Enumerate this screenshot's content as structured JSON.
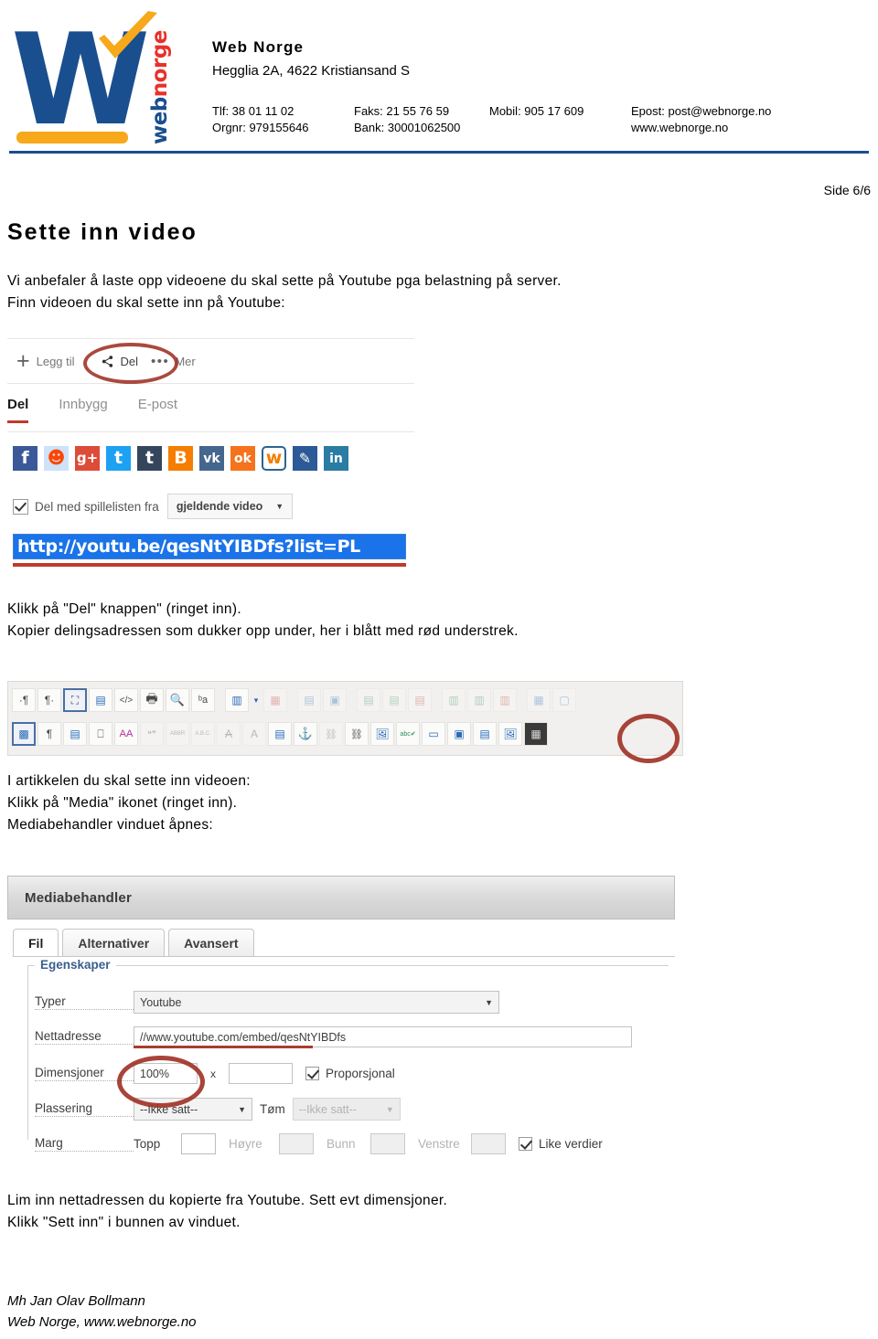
{
  "letterhead": {
    "logo": {
      "letter": "W",
      "vertical_web": "web",
      "vertical_norge": "norge"
    },
    "company_name": "Web Norge",
    "address": "Hegglia 2A, 4622 Kristiansand S",
    "contacts": {
      "tlf": "Tlf: 38 01 11 02",
      "faks": "Faks: 21 55 76 59",
      "mobil": "Mobil: 905 17 609",
      "epost": "Epost: post@webnorge.no",
      "orgnr": "Orgnr: 979155646",
      "bank": "Bank: 30001062500",
      "web": "www.webnorge.no"
    }
  },
  "page": {
    "page_number": "Side 6/6",
    "title": "Sette inn video",
    "intro": "Vi anbefaler å laste opp videoene du skal sette på Youtube pga belastning på server.\nFinn videoen du skal sette inn på Youtube:",
    "after_share": "Klikk på \"Del\" knappen\" (ringet inn).\nKopier delingsadressen som dukker opp under, her i blått med rød understrek.",
    "after_toolbar": "I artikkelen du skal sette inn videoen:\nKlikk på \"Media\" ikonet (ringet inn).\nMediabehandler vinduet åpnes:",
    "after_dialog": "Lim inn nettadressen du kopierte fra Youtube. Sett evt dimensjoner.\nKlikk \"Sett inn\" i bunnen av vinduet.",
    "signature": "Mh Jan Olav Bollmann\nWeb Norge, www.webnorge.no"
  },
  "youtube_share": {
    "toolbar": {
      "add_label": "Legg til",
      "share_label": "Del",
      "more_label": "Mer",
      "dots": "•••"
    },
    "tabs": [
      {
        "label": "Del",
        "active": true
      },
      {
        "label": "Innbygg",
        "active": false
      },
      {
        "label": "E-post",
        "active": false
      }
    ],
    "socials": [
      {
        "name": "facebook",
        "glyph": "f",
        "bg": "#3b5998",
        "fg": "#ffffff"
      },
      {
        "name": "reddit",
        "glyph": "☻",
        "bg": "#cee3f8",
        "fg": "#ff4500"
      },
      {
        "name": "google-plus",
        "glyph": "g+",
        "bg": "#dd4b39",
        "fg": "#ffffff"
      },
      {
        "name": "twitter",
        "glyph": "t",
        "bg": "#1da1f2",
        "fg": "#ffffff"
      },
      {
        "name": "tumblr",
        "glyph": "t",
        "bg": "#35465c",
        "fg": "#ffffff"
      },
      {
        "name": "blogger",
        "glyph": "B",
        "bg": "#f57d00",
        "fg": "#ffffff"
      },
      {
        "name": "vk",
        "glyph": "vk",
        "bg": "#45668e",
        "fg": "#ffffff"
      },
      {
        "name": "odnoklassniki",
        "glyph": "ok",
        "bg": "#f4731c",
        "fg": "#ffffff"
      },
      {
        "name": "weibo",
        "glyph": "w",
        "bg": "#ffffff",
        "fg": "#f57d00"
      },
      {
        "name": "pencil-blog",
        "glyph": "✎",
        "bg": "#2b5a96",
        "fg": "#ffffff"
      },
      {
        "name": "linkedin",
        "glyph": "in",
        "bg": "#2a7ca3",
        "fg": "#ffffff"
      }
    ],
    "playlist": {
      "checkbox_label": "Del med spillelisten fra",
      "checked": true,
      "select_value": "gjeldende video",
      "caret": "▼"
    },
    "url": "http://youtu.be/qesNtYIBDfs?list=PL"
  },
  "editor_toolbar": {
    "row1": [
      {
        "name": "pilcrow-ltr-icon",
        "glyph": "·¶",
        "state": "normal"
      },
      {
        "name": "pilcrow-rtl-icon",
        "glyph": "¶·",
        "state": "normal"
      },
      {
        "name": "fullscreen-icon",
        "glyph": "⛶",
        "state": "selected"
      },
      {
        "name": "edit-source-icon",
        "glyph": "▤",
        "state": "normal"
      },
      {
        "name": "html-code-icon",
        "glyph": "<>",
        "state": "normal"
      },
      {
        "name": "print-icon",
        "glyph": "🖶",
        "state": "normal"
      },
      {
        "name": "search-icon",
        "glyph": "⚲⚲",
        "state": "normal"
      },
      {
        "name": "replace-icon",
        "glyph": "ᵇa",
        "state": "normal"
      },
      {
        "name": "sep",
        "glyph": "",
        "state": "sep"
      },
      {
        "name": "template-icon",
        "glyph": "▥",
        "state": "normal"
      },
      {
        "name": "template-dropdown-icon",
        "glyph": "▾",
        "state": "caret"
      },
      {
        "name": "delete-table-icon",
        "glyph": "▦",
        "state": "dim"
      },
      {
        "name": "sep",
        "glyph": "",
        "state": "sep"
      },
      {
        "name": "row-properties-icon",
        "glyph": "▤",
        "state": "dim"
      },
      {
        "name": "cell-properties-icon",
        "glyph": "▣",
        "state": "dim"
      },
      {
        "name": "sep",
        "glyph": "",
        "state": "sep"
      },
      {
        "name": "insert-row-before-icon",
        "glyph": "▤",
        "state": "dim"
      },
      {
        "name": "insert-row-after-icon",
        "glyph": "▤",
        "state": "dim"
      },
      {
        "name": "delete-row-icon",
        "glyph": "▤",
        "state": "dim"
      },
      {
        "name": "sep",
        "glyph": "",
        "state": "sep"
      },
      {
        "name": "insert-col-before-icon",
        "glyph": "▥",
        "state": "dim"
      },
      {
        "name": "insert-col-after-icon",
        "glyph": "▥",
        "state": "dim"
      },
      {
        "name": "delete-col-icon",
        "glyph": "▥",
        "state": "dim"
      },
      {
        "name": "sep",
        "glyph": "",
        "state": "sep"
      },
      {
        "name": "split-cell-icon",
        "glyph": "▦",
        "state": "dim"
      },
      {
        "name": "merge-cell-icon",
        "glyph": "▢",
        "state": "dim"
      }
    ],
    "row2": [
      {
        "name": "show-blocks-icon",
        "glyph": "▩",
        "state": "selected"
      },
      {
        "name": "paragraph-icon",
        "glyph": "¶",
        "state": "normal"
      },
      {
        "name": "page-properties-icon",
        "glyph": "▤",
        "state": "normal"
      },
      {
        "name": "page-break-icon",
        "glyph": "⎕",
        "state": "normal"
      },
      {
        "name": "font-style-icon",
        "glyph": "AA",
        "state": "normal"
      },
      {
        "name": "blockquote-icon",
        "glyph": "❝❞",
        "state": "dim"
      },
      {
        "name": "abbreviation-icon",
        "glyph": "ABBR",
        "state": "dim"
      },
      {
        "name": "acronym-icon",
        "glyph": "A.B.C.",
        "state": "dim"
      },
      {
        "name": "strikethrough-icon",
        "glyph": "A̶",
        "state": "dim"
      },
      {
        "name": "underline-icon",
        "glyph": "A",
        "state": "dim"
      },
      {
        "name": "notes-icon",
        "glyph": "▤",
        "state": "normal"
      },
      {
        "name": "anchor-icon",
        "glyph": "⚓",
        "state": "normal"
      },
      {
        "name": "unlink-icon",
        "glyph": "⛓",
        "state": "dim"
      },
      {
        "name": "link-icon",
        "glyph": "⛓",
        "state": "normal"
      },
      {
        "name": "insert-image-icon",
        "glyph": "🖼",
        "state": "normal"
      },
      {
        "name": "spellcheck-icon",
        "glyph": "abc✔",
        "state": "normal"
      },
      {
        "name": "insert-layer-icon",
        "glyph": "▭",
        "state": "normal"
      },
      {
        "name": "layout-icon",
        "glyph": "▣",
        "state": "normal"
      },
      {
        "name": "attachment-icon",
        "glyph": "▤",
        "state": "normal"
      },
      {
        "name": "image-manager-icon",
        "glyph": "🖼",
        "state": "normal"
      },
      {
        "name": "media-icon",
        "glyph": "▦",
        "state": "media"
      }
    ]
  },
  "mediabehandler": {
    "title": "Mediabehandler",
    "tabs": [
      {
        "label": "Fil",
        "active": true
      },
      {
        "label": "Alternativer",
        "active": false
      },
      {
        "label": "Avansert",
        "active": false
      }
    ],
    "legend": "Egenskaper",
    "fields": {
      "typer_label": "Typer",
      "typer_value": "Youtube",
      "url_label": "Nettadresse",
      "url_value": "//www.youtube.com/embed/qesNtYIBDfs",
      "dim_label": "Dimensjoner",
      "dim_width": "100%",
      "dim_x": "x",
      "dim_height": "",
      "proportional_label": "Proporsjonal",
      "proportional_checked": true,
      "placement_label": "Plassering",
      "placement_value": "--Ikke satt--",
      "clear_label": "Tøm",
      "clear_value": "--Ikke satt--",
      "margin_label": "Marg",
      "margin_top_label": "Topp",
      "margin_right_label": "Høyre",
      "margin_bottom_label": "Bunn",
      "margin_left_label": "Venstre",
      "equal_values_label": "Like verdier",
      "equal_values_checked": true,
      "caret": "▼"
    }
  },
  "colors": {
    "brand_blue": "#1a4f8f",
    "brand_orange": "#f7a81b",
    "brand_red": "#e8312a",
    "annotation_red": "#9e3023",
    "link_blue": "#1a73e8"
  }
}
